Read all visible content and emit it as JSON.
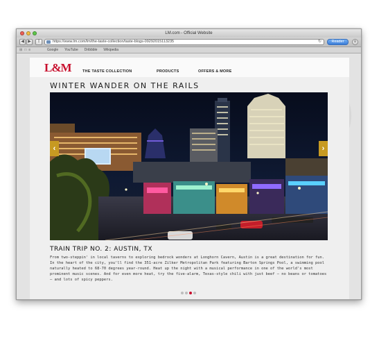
{
  "browser": {
    "window_title": "LM.com - Official Website",
    "url": "https://www.lm.com/lm/the-taste-collection/taste-blogs-09292015113235",
    "reader_label": "Reader",
    "back_glyph": "◀",
    "forward_glyph": "▶",
    "share_glyph": "⇪",
    "reload_glyph": "↻",
    "settings_glyph": "⚙",
    "bookmarks": [
      "Google",
      "YouTube",
      "Dribbble",
      "Wikipedia"
    ],
    "bookmark_icons": [
      "⊞",
      "□",
      "≡"
    ]
  },
  "site": {
    "logo": "L&M",
    "nav": [
      "THE TASTE COLLECTION",
      "PRODUCTS",
      "OFFERS & MORE"
    ],
    "page_title": "WINTER WANDER ON THE RAILS",
    "slide_subtitle": "TRAIN TRIP NO. 2: AUSTIN, TX",
    "body": "From two-steppin' in local taverns to exploring bedrock wonders at Longhorn Cavern, Austin is a great destination for fun. In the heart of the city, you'll find the 351-acre Zilker Metropolitan Park featuring Barton Springs Pool, a swimming pool naturally heated to 68-70 degrees year-round. Heat up the night with a musical performance in one of the world's most prominent music scenes. And for even more heat, try the five-alarm, Texas-style chili with just beef – no beans or tomatoes – and lots of spicy peppers.",
    "prev_glyph": "‹",
    "next_glyph": "›",
    "slides": {
      "count": 4,
      "active": 3
    },
    "colors": {
      "brand_red": "#c8102e",
      "arrow_gold": "#c79a22",
      "reader_blue": "#3b7dd8"
    }
  }
}
